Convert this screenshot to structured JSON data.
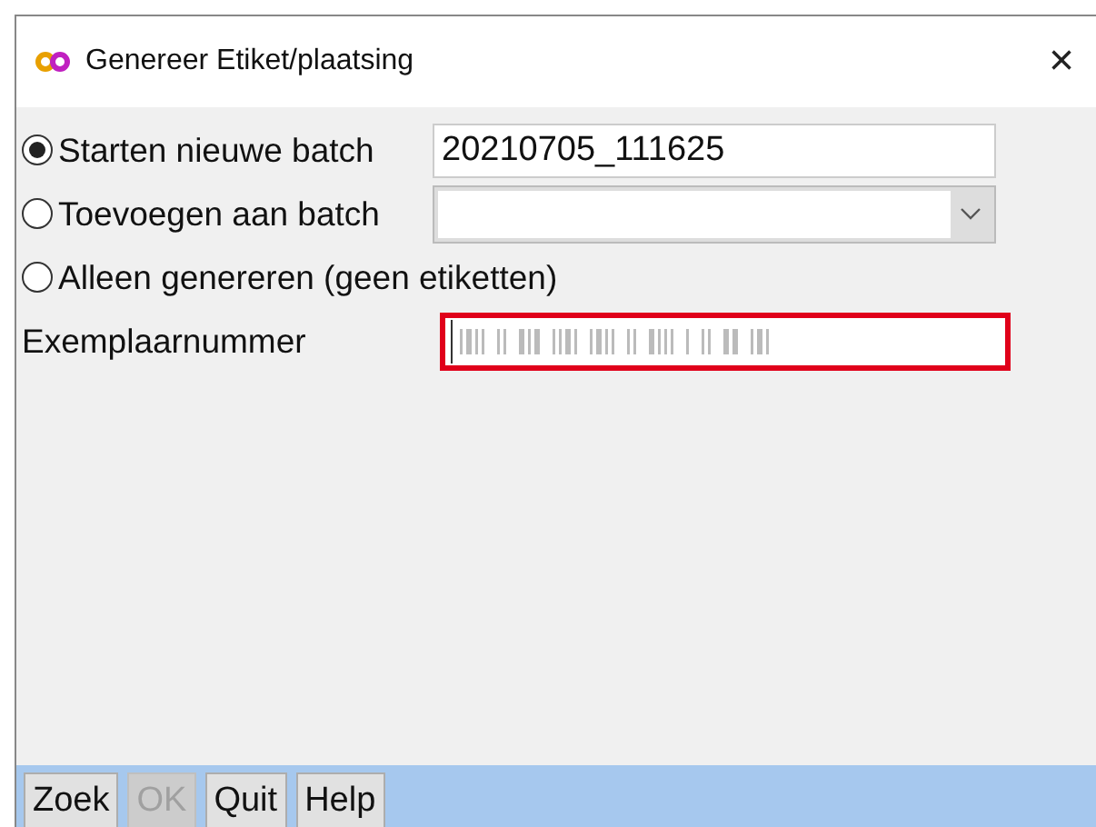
{
  "window": {
    "title": "Genereer Etiket/plaatsing",
    "close": "×"
  },
  "options": [
    {
      "kind": "text",
      "label": "Starten nieuwe batch",
      "selected": true,
      "value": "20210705_111625"
    },
    {
      "kind": "select",
      "label": "Toevoegen aan batch",
      "selected": false
    },
    {
      "kind": "plain",
      "label": "Alleen genereren (geen etiketten)",
      "selected": false
    }
  ],
  "copy_number": {
    "label": "Exemplaarnummer",
    "highlighted": true
  },
  "buttons": [
    {
      "label": "Zoek",
      "disabled": false
    },
    {
      "label": "OK",
      "disabled": true
    },
    {
      "label": "Quit",
      "disabled": false
    },
    {
      "label": "Help",
      "disabled": false
    }
  ]
}
